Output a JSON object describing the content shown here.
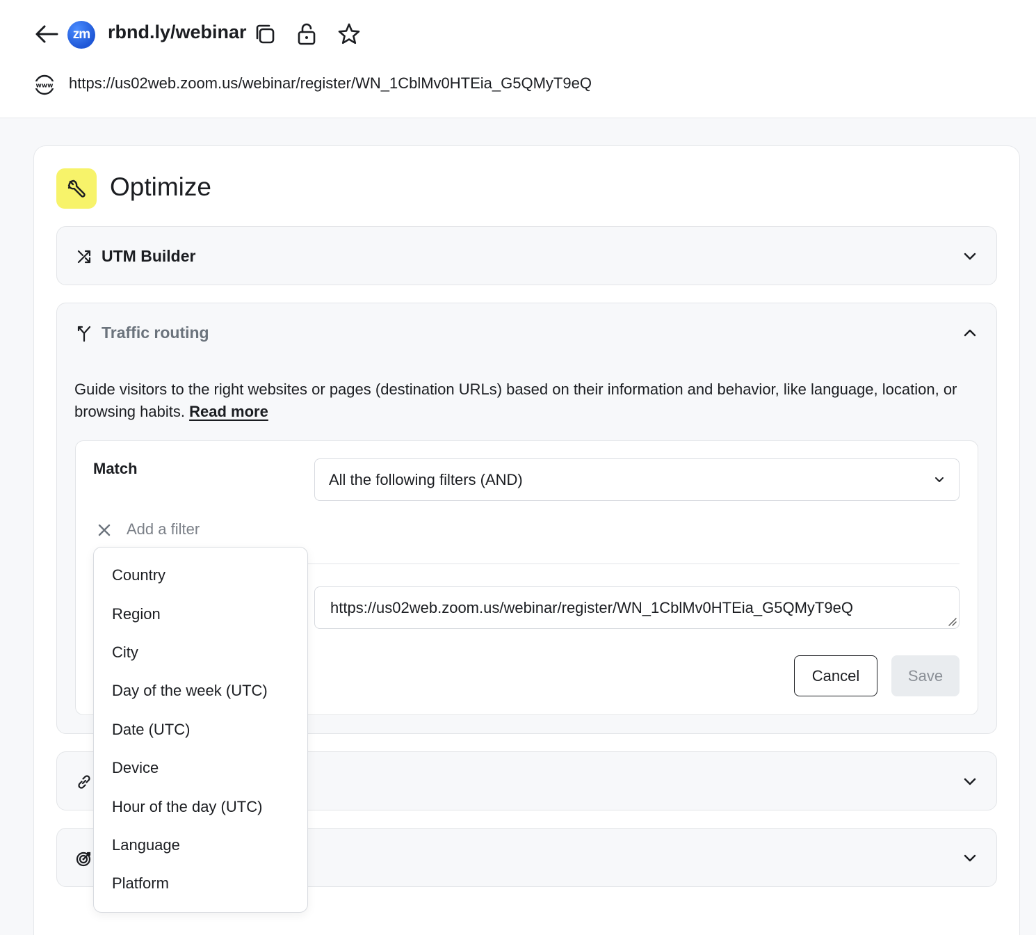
{
  "header": {
    "short_link": "rbnd.ly/webinar",
    "favicon_text": "zm",
    "destination_url": "https://us02web.zoom.us/webinar/register/WN_1CblMv0HTEia_G5QMyT9eQ",
    "icons": [
      "back-arrow-icon",
      "copy-icon",
      "unlock-icon",
      "star-icon",
      "globe-www-icon"
    ]
  },
  "optimize": {
    "title": "Optimize",
    "icon": "wrench-icon",
    "accent_color": "#f7f36a"
  },
  "utm_builder": {
    "title": "UTM Builder",
    "icon": "shuffle-icon"
  },
  "traffic_routing": {
    "title": "Traffic routing",
    "icon": "split-route-icon",
    "description": "Guide visitors to the right websites or pages (destination URLs) based on their information and behavior, like language, location, or browsing habits.",
    "read_more": "Read more",
    "match_label": "Match",
    "match_value": "All the following filters (AND)",
    "add_filter_placeholder": "Add a filter",
    "url_value": "https://us02web.zoom.us/webinar/register/WN_1CblMv0HTEia_G5QMyT9eQ",
    "cancel_label": "Cancel",
    "save_label": "Save"
  },
  "filter_options": [
    "Country",
    "Region",
    "City",
    "Day of the week (UTC)",
    "Date (UTC)",
    "Device",
    "Hour of the day (UTC)",
    "Language",
    "Platform"
  ],
  "collapsed_sections": [
    {
      "icon": "link-icon"
    },
    {
      "icon": "target-icon"
    }
  ]
}
